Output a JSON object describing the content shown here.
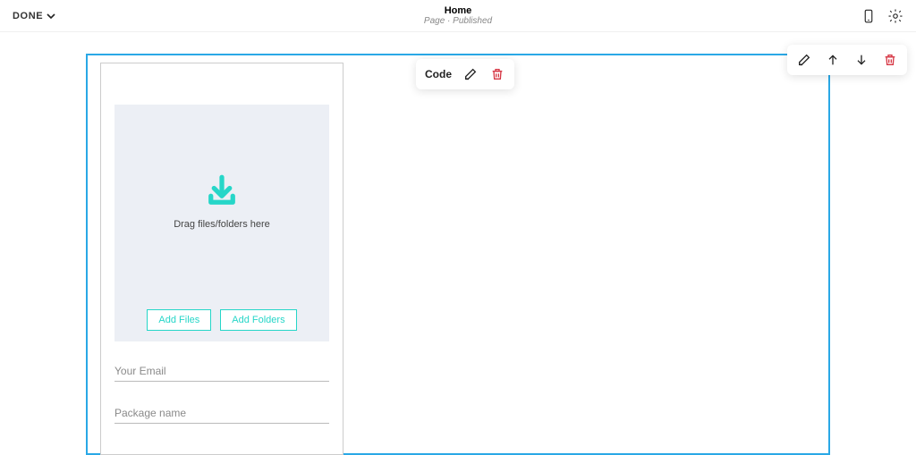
{
  "topbar": {
    "done_label": "DONE",
    "title": "Home",
    "subtitle": "Page · Published"
  },
  "code_toolbar": {
    "label": "Code"
  },
  "widget": {
    "dropzone_text": "Drag files/folders here",
    "add_files_label": "Add Files",
    "add_folders_label": "Add Folders",
    "email_placeholder": "Your Email",
    "package_placeholder": "Package name"
  }
}
